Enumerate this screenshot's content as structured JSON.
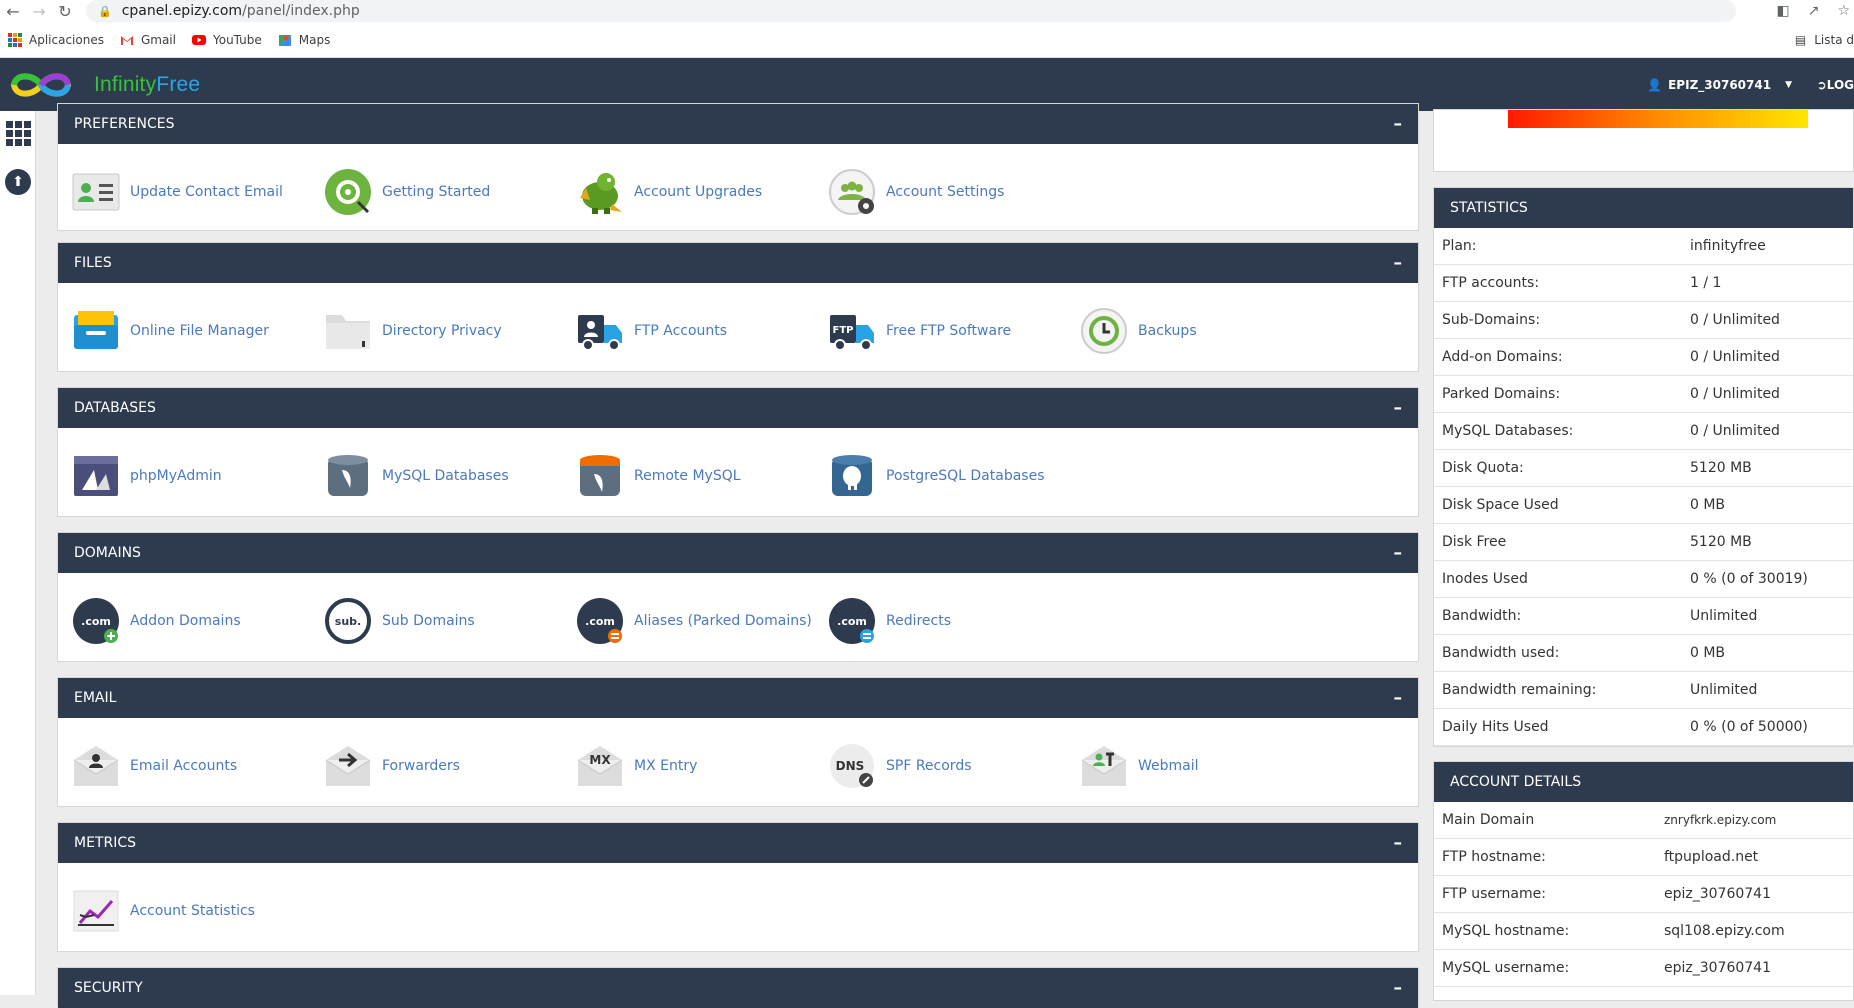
{
  "browser": {
    "url_host": "cpanel.epizy.com",
    "url_path": "/panel/index.php",
    "bookmarks": [
      {
        "label": "Aplicaciones"
      },
      {
        "label": "Gmail"
      },
      {
        "label": "YouTube"
      },
      {
        "label": "Maps"
      }
    ],
    "reading_list": "Lista d"
  },
  "header": {
    "logo_part1": "Infinity",
    "logo_part2": "Free",
    "user": "EPIZ_30760741",
    "logout": "LOG"
  },
  "sections": {
    "preferences": {
      "title": "PREFERENCES",
      "items": [
        {
          "label": "Update Contact Email",
          "icon": "contact-card-icon"
        },
        {
          "label": "Getting Started",
          "icon": "getting-started-icon"
        },
        {
          "label": "Account Upgrades",
          "icon": "dragon-icon"
        },
        {
          "label": "Account Settings",
          "icon": "account-settings-icon"
        }
      ]
    },
    "files": {
      "title": "FILES",
      "items": [
        {
          "label": "Online File Manager",
          "icon": "file-manager-icon"
        },
        {
          "label": "Directory Privacy",
          "icon": "folder-lock-icon"
        },
        {
          "label": "FTP Accounts",
          "icon": "ftp-accounts-icon"
        },
        {
          "label": "Free FTP Software",
          "icon": "ftp-truck-icon"
        },
        {
          "label": "Backups",
          "icon": "backup-icon"
        }
      ]
    },
    "databases": {
      "title": "DATABASES",
      "items": [
        {
          "label": "phpMyAdmin",
          "icon": "phpmyadmin-icon"
        },
        {
          "label": "MySQL Databases",
          "icon": "mysql-icon"
        },
        {
          "label": "Remote MySQL",
          "icon": "remote-mysql-icon"
        },
        {
          "label": "PostgreSQL Databases",
          "icon": "postgresql-icon"
        }
      ]
    },
    "domains": {
      "title": "DOMAINS",
      "items": [
        {
          "label": "Addon Domains",
          "icon": "addon-domain-icon",
          "badge": ".com"
        },
        {
          "label": "Sub Domains",
          "icon": "subdomain-icon",
          "badge": "sub."
        },
        {
          "label": "Aliases (Parked Domains)",
          "icon": "parked-domain-icon",
          "badge": ".com"
        },
        {
          "label": "Redirects",
          "icon": "redirect-icon",
          "badge": ".com"
        }
      ]
    },
    "email": {
      "title": "EMAIL",
      "items": [
        {
          "label": "Email Accounts",
          "icon": "email-account-icon"
        },
        {
          "label": "Forwarders",
          "icon": "forwarder-icon"
        },
        {
          "label": "MX Entry",
          "icon": "mx-entry-icon",
          "badge": "MX"
        },
        {
          "label": "SPF Records",
          "icon": "dns-icon",
          "badge": "DNS"
        },
        {
          "label": "Webmail",
          "icon": "webmail-icon"
        }
      ]
    },
    "metrics": {
      "title": "METRICS",
      "items": [
        {
          "label": "Account Statistics",
          "icon": "stats-chart-icon"
        }
      ]
    },
    "security": {
      "title": "SECURITY"
    }
  },
  "statistics": {
    "title": "STATISTICS",
    "rows": [
      {
        "k": "Plan:",
        "v": "infinityfree"
      },
      {
        "k": "FTP accounts:",
        "v": "1 / 1"
      },
      {
        "k": "Sub-Domains:",
        "v": "0 / Unlimited"
      },
      {
        "k": "Add-on Domains:",
        "v": "0 / Unlimited"
      },
      {
        "k": "Parked Domains:",
        "v": "0 / Unlimited"
      },
      {
        "k": "MySQL Databases:",
        "v": "0 / Unlimited"
      },
      {
        "k": "Disk Quota:",
        "v": "5120 MB"
      },
      {
        "k": "Disk Space Used",
        "v": "0 MB"
      },
      {
        "k": "Disk Free",
        "v": "5120 MB"
      },
      {
        "k": "Inodes Used",
        "v": "0 % (0 of 30019)"
      },
      {
        "k": "Bandwidth:",
        "v": "Unlimited"
      },
      {
        "k": "Bandwidth used:",
        "v": "0 MB"
      },
      {
        "k": "Bandwidth remaining:",
        "v": "Unlimited"
      },
      {
        "k": "Daily Hits Used",
        "v": "0 % (0 of 50000)"
      }
    ]
  },
  "account_details": {
    "title": "ACCOUNT DETAILS",
    "rows": [
      {
        "k": "Main Domain",
        "v": "znryfkrk.epizy.com"
      },
      {
        "k": "FTP hostname:",
        "v": "ftpupload.net"
      },
      {
        "k": "FTP username:",
        "v": "epiz_30760741"
      },
      {
        "k": "MySQL hostname:",
        "v": "sql108.epizy.com"
      },
      {
        "k": "MySQL username:",
        "v": "epiz_30760741"
      }
    ]
  },
  "colors": {
    "header_bg": "#2e3b4e",
    "link": "#4a79bd",
    "brand_green": "#35c33a",
    "brand_blue": "#2aa5e8"
  }
}
